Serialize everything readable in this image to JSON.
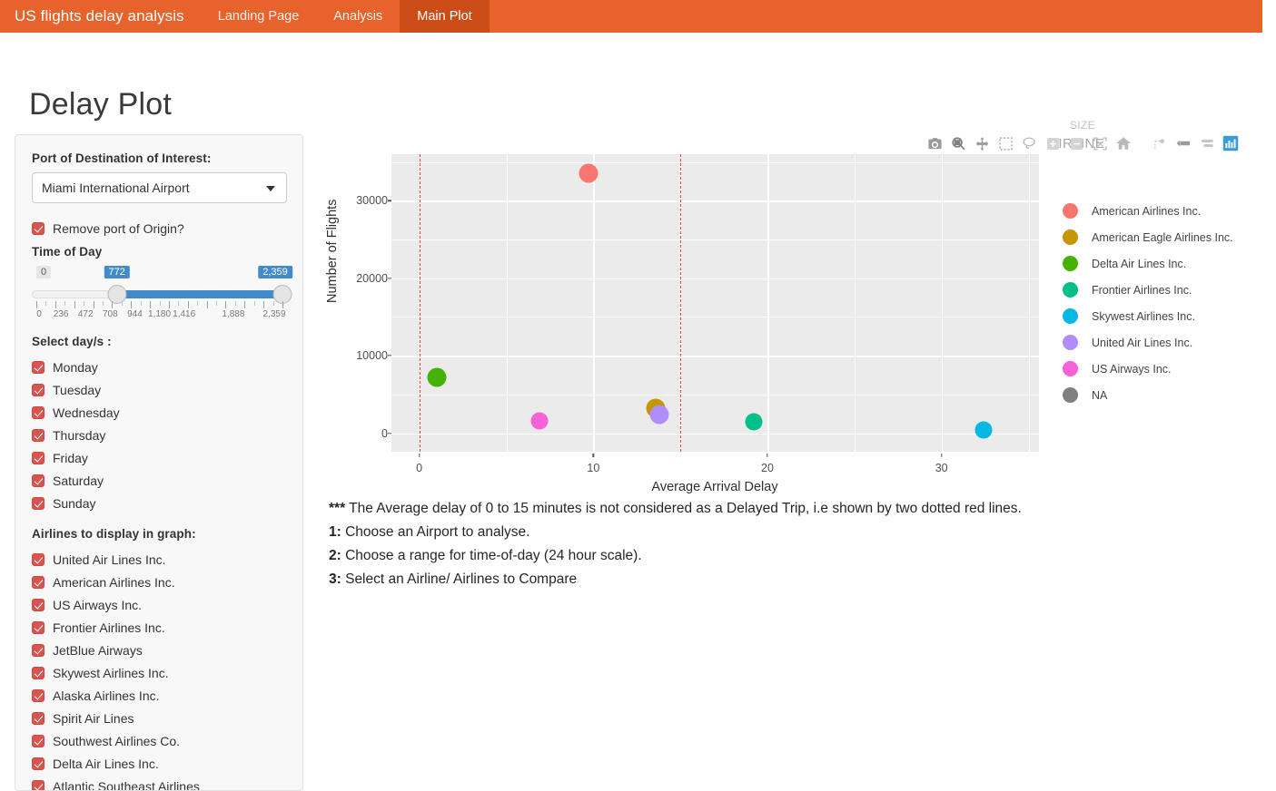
{
  "navbar": {
    "brand": "US flights delay analysis",
    "links": [
      {
        "label": "Landing Page",
        "active": false
      },
      {
        "label": "Analysis",
        "active": false
      },
      {
        "label": "Main Plot",
        "active": true
      }
    ],
    "bg_color": "#e8622b",
    "active_bg_color": "#cc4c17"
  },
  "page": {
    "title": "Delay Plot"
  },
  "sidebar": {
    "airport": {
      "label": "Port of Destination of Interest:",
      "selected": "Miami International Airport"
    },
    "remove_origin": {
      "label": "Remove port of Origin?",
      "checked": true
    },
    "time_of_day": {
      "label": "Time of Day",
      "min_badge": "0",
      "low_badge": "772",
      "high_badge": "2,359",
      "min": 0,
      "max": 2359,
      "low": 772,
      "high": 2359,
      "tick_labels": [
        "0",
        "236",
        "472",
        "708",
        "944",
        "1,180",
        "1,416",
        "1,888",
        "2,359"
      ],
      "tick_values": [
        0,
        236,
        472,
        708,
        944,
        1180,
        1416,
        1888,
        2359
      ]
    },
    "days": {
      "label": "Select day/s :",
      "items": [
        {
          "label": "Monday",
          "checked": true
        },
        {
          "label": "Tuesday",
          "checked": true
        },
        {
          "label": "Wednesday",
          "checked": true
        },
        {
          "label": "Thursday",
          "checked": true
        },
        {
          "label": "Friday",
          "checked": true
        },
        {
          "label": "Saturday",
          "checked": true
        },
        {
          "label": "Sunday",
          "checked": true
        }
      ]
    },
    "airlines": {
      "label": "Airlines to display in graph:",
      "items": [
        {
          "label": "United Air Lines Inc.",
          "checked": true
        },
        {
          "label": "American Airlines Inc.",
          "checked": true
        },
        {
          "label": "US Airways Inc.",
          "checked": true
        },
        {
          "label": "Frontier Airlines Inc.",
          "checked": true
        },
        {
          "label": "JetBlue Airways",
          "checked": true
        },
        {
          "label": "Skywest Airlines Inc.",
          "checked": true
        },
        {
          "label": "Alaska Airlines Inc.",
          "checked": true
        },
        {
          "label": "Spirit Air Lines",
          "checked": true
        },
        {
          "label": "Southwest Airlines Co.",
          "checked": true
        },
        {
          "label": "Delta Air Lines Inc.",
          "checked": true
        },
        {
          "label": "Atlantic Southeast Airlines",
          "checked": true
        }
      ]
    },
    "checkbox_color": "#d9534f"
  },
  "modebar": {
    "buttons": [
      "camera-icon",
      "zoom-icon",
      "pan-icon",
      "box-select-icon",
      "lasso-select-icon",
      "zoom-in-icon",
      "zoom-out-icon",
      "autoscale-icon",
      "home-icon",
      "spike-lines-icon",
      "hover-closest-icon",
      "hover-compare-icon",
      "plotly-logo-icon"
    ],
    "active_color": "#3b9bd6"
  },
  "legend": {
    "group_title_size": "SIZE",
    "group_title_airline": "AIRLINE",
    "entries": [
      {
        "label": "American Airlines Inc.",
        "color": "#f8766d"
      },
      {
        "label": "American Eagle Airlines Inc.",
        "color": "#c59600"
      },
      {
        "label": "Delta Air Lines Inc.",
        "color": "#43b300"
      },
      {
        "label": "Frontier Airlines Inc.",
        "color": "#00bf89"
      },
      {
        "label": "Skywest Airlines Inc.",
        "color": "#05b8e3"
      },
      {
        "label": "United Air Lines Inc.",
        "color": "#af8dfb"
      },
      {
        "label": "US Airways Inc.",
        "color": "#fb61d7"
      },
      {
        "label": "NA",
        "color": "#808080"
      }
    ]
  },
  "chart_data": {
    "type": "scatter",
    "title": "",
    "xlabel": "Average Arrival Delay",
    "ylabel": "Number of Flights",
    "xlim": [
      -1.6,
      35.6
    ],
    "ylim": [
      -2400,
      36000
    ],
    "xticks": [
      0,
      10,
      20,
      30
    ],
    "xtick_labels": [
      "0",
      "10",
      "20",
      "30"
    ],
    "yticks": [
      0,
      10000,
      20000,
      30000
    ],
    "ytick_labels": [
      "0",
      "10000",
      "20000",
      "30000"
    ],
    "grid": true,
    "panel_bg": "#ebebeb",
    "legend_position": "right",
    "reference_lines": [
      {
        "x": 0,
        "style": "dashed",
        "color": "#e8433a"
      },
      {
        "x": 15,
        "style": "dashed",
        "color": "#e8433a"
      }
    ],
    "points": [
      {
        "name": "American Airlines Inc.",
        "x": 9.7,
        "y": 33600,
        "color": "#f8766d",
        "size": 21
      },
      {
        "name": "Delta Air Lines Inc.",
        "x": 1.0,
        "y": 7150,
        "color": "#43b300",
        "size": 21
      },
      {
        "name": "American Eagle Airlines Inc.",
        "x": 13.6,
        "y": 3200,
        "color": "#c59600",
        "size": 21
      },
      {
        "name": "United Air Lines Inc.",
        "x": 13.8,
        "y": 2400,
        "color": "#af8dfb",
        "size": 21
      },
      {
        "name": "US Airways Inc.",
        "x": 6.9,
        "y": 1550,
        "color": "#fb61d7",
        "size": 19
      },
      {
        "name": "Frontier Airlines Inc.",
        "x": 19.2,
        "y": 1500,
        "color": "#00bf89",
        "size": 19
      },
      {
        "name": "Skywest Airlines Inc.",
        "x": 32.4,
        "y": 400,
        "color": "#05b8e3",
        "size": 19
      }
    ]
  },
  "notes": {
    "line0_prefix": "***",
    "line0": " The Average delay of 0 to 15 minutes is not considered as a Delayed Trip, i.e shown by two dotted red lines.",
    "line1_prefix": "1:",
    "line1": " Choose an Airport to analyse.",
    "line2_prefix": "2:",
    "line2": " Choose a range for time-of-day (24 hour scale).",
    "line3_prefix": "3:",
    "line3": " Select an Airline/ Airlines to Compare"
  }
}
